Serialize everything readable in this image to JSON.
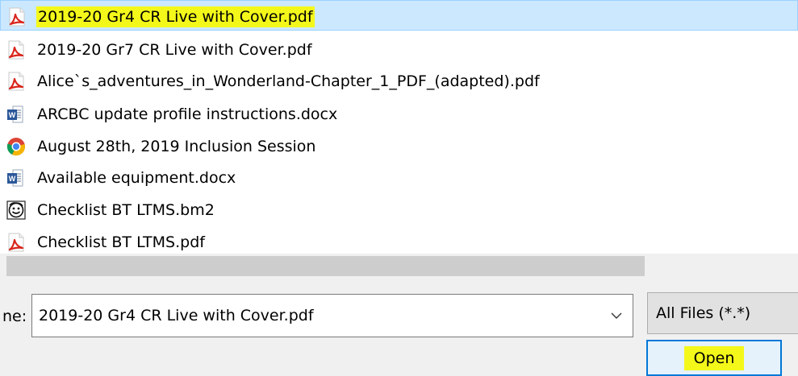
{
  "file_list": {
    "items": [
      {
        "name": "2019-20 Gr4 CR Live with Cover.pdf",
        "icon": "pdf-icon",
        "selected": true,
        "highlighted": true
      },
      {
        "name": "2019-20 Gr7 CR Live with Cover.pdf",
        "icon": "pdf-icon"
      },
      {
        "name": "Alice`s_adventures_in_Wonderland-Chapter_1_PDF_(adapted).pdf",
        "icon": "pdf-icon"
      },
      {
        "name": "ARCBC update profile instructions.docx",
        "icon": "word-document-icon"
      },
      {
        "name": "August 28th, 2019 Inclusion Session",
        "icon": "chrome-icon"
      },
      {
        "name": "Available equipment.docx",
        "icon": "word-document-icon"
      },
      {
        "name": "Checklist BT LTMS.bm2",
        "icon": "boardmaker-icon"
      },
      {
        "name": "Checklist BT LTMS.pdf",
        "icon": "pdf-icon"
      }
    ]
  },
  "file_name": {
    "label": "ne:",
    "value": "2019-20 Gr4 CR Live with Cover.pdf"
  },
  "file_type": {
    "value": "All Files (*.*)"
  },
  "buttons": {
    "open_label": "Open"
  },
  "colors": {
    "selection": "#cce8ff",
    "highlight": "#f4f81a",
    "focus_border": "#0078d7",
    "pdf_red": "#d9251c",
    "word_blue": "#2b579a"
  }
}
